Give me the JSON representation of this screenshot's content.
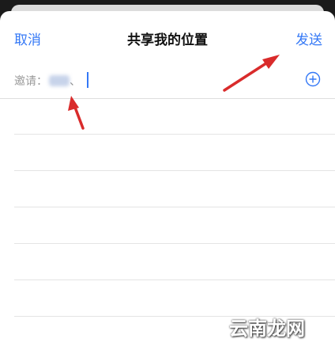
{
  "header": {
    "cancel_label": "取消",
    "title": "共享我的位置",
    "send_label": "发送"
  },
  "invite": {
    "label": "邀请：",
    "recipient_suffix": "、"
  },
  "watermark": {
    "text": "云南龙网"
  },
  "colors": {
    "accent": "#3478f6",
    "annotation_arrow": "#d92b2b"
  },
  "icons": {
    "add": "plus-circle-icon"
  }
}
